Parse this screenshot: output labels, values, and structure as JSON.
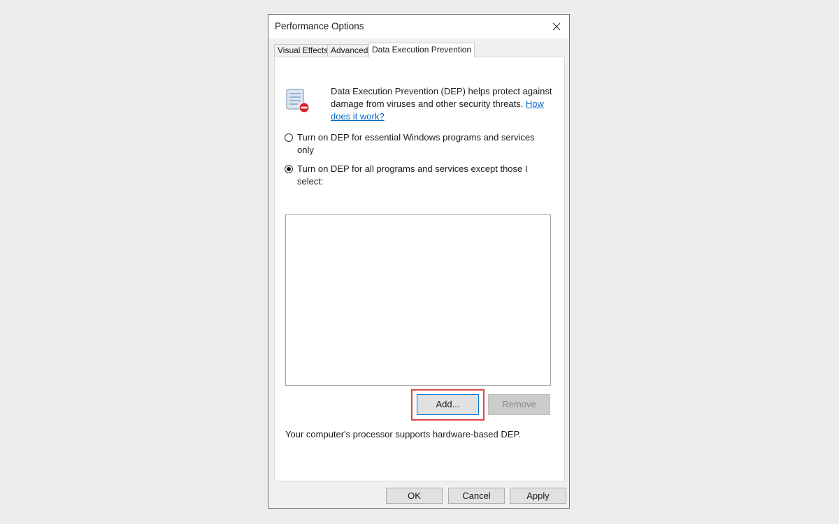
{
  "window": {
    "title": "Performance Options"
  },
  "tabs": [
    {
      "label": "Visual Effects"
    },
    {
      "label": "Advanced"
    },
    {
      "label": "Data Execution Prevention",
      "active": true
    }
  ],
  "dep": {
    "description": "Data Execution Prevention (DEP) helps protect against damage from viruses and other security threats.",
    "link": "How does it work?",
    "options": [
      {
        "label": "Turn on DEP for essential Windows programs and services only",
        "checked": false
      },
      {
        "label": "Turn on DEP for all programs and services except those I select:",
        "checked": true
      }
    ],
    "program_list": [],
    "add_label": "Add...",
    "remove_label": "Remove",
    "status": "Your computer's processor supports hardware-based DEP."
  },
  "footer": {
    "ok_label": "OK",
    "cancel_label": "Cancel",
    "apply_label": "Apply"
  },
  "colors": {
    "highlight": "#e0454a",
    "link": "#0066cc",
    "focus": "#0078d7"
  }
}
